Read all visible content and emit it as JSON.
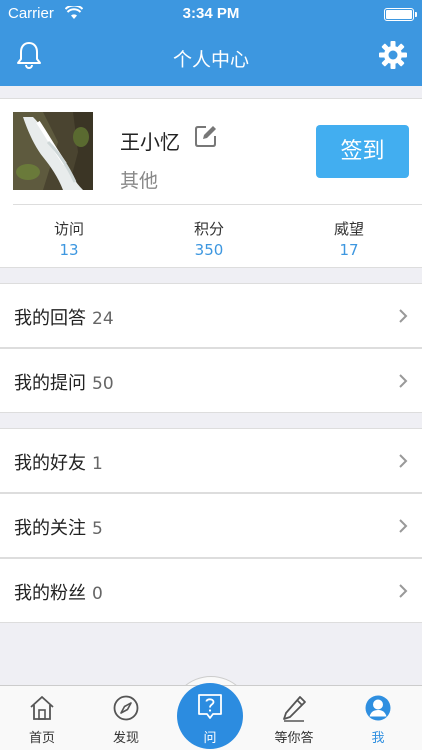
{
  "status_bar": {
    "carrier": "Carrier",
    "time": "3:34 PM"
  },
  "header": {
    "title": "个人中心",
    "left_icon": "bell-icon",
    "right_icon": "gear-icon",
    "color": "#3d97e0"
  },
  "profile": {
    "name": "王小忆",
    "role": "其他",
    "checkin_label": "签到",
    "stats": [
      {
        "label": "访问",
        "value": "13"
      },
      {
        "label": "积分",
        "value": "350"
      },
      {
        "label": "威望",
        "value": "17"
      }
    ]
  },
  "menu": [
    {
      "label": "我的回答",
      "count": "24"
    },
    {
      "label": "我的提问",
      "count": "50"
    },
    {
      "label": "我的好友",
      "count": "1"
    },
    {
      "label": "我的关注",
      "count": "5"
    },
    {
      "label": "我的粉丝",
      "count": "0"
    }
  ],
  "tabs": [
    {
      "label": "首页",
      "icon": "home-icon"
    },
    {
      "label": "发现",
      "icon": "compass-icon"
    },
    {
      "label": "问",
      "icon": "question-icon"
    },
    {
      "label": "等你答",
      "icon": "pen-icon"
    },
    {
      "label": "我",
      "icon": "user-icon",
      "active": true
    }
  ]
}
